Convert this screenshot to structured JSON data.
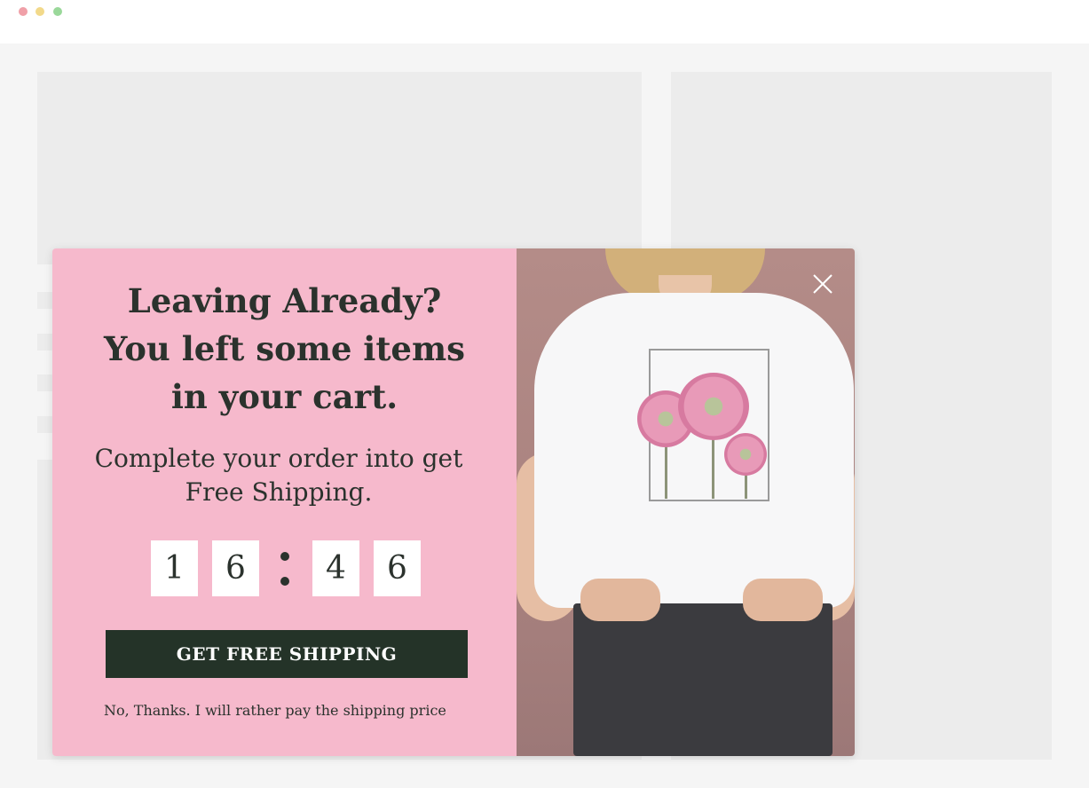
{
  "popup": {
    "headline_line1": "Leaving Already?",
    "headline_line2": "You left some items",
    "headline_line3": "in your cart.",
    "subline_line1": "Complete your order into get",
    "subline_line2": "Free Shipping.",
    "countdown": {
      "digits": [
        "1",
        "6",
        "4",
        "6"
      ]
    },
    "cta_label": "GET FREE SHIPPING",
    "decline_label": "No, Thanks. I will rather pay the shipping price"
  },
  "colors": {
    "popup_background": "#f6b9cc",
    "cta_background": "#243328",
    "text": "#2b322d"
  },
  "icons": {
    "close": "close-icon"
  }
}
